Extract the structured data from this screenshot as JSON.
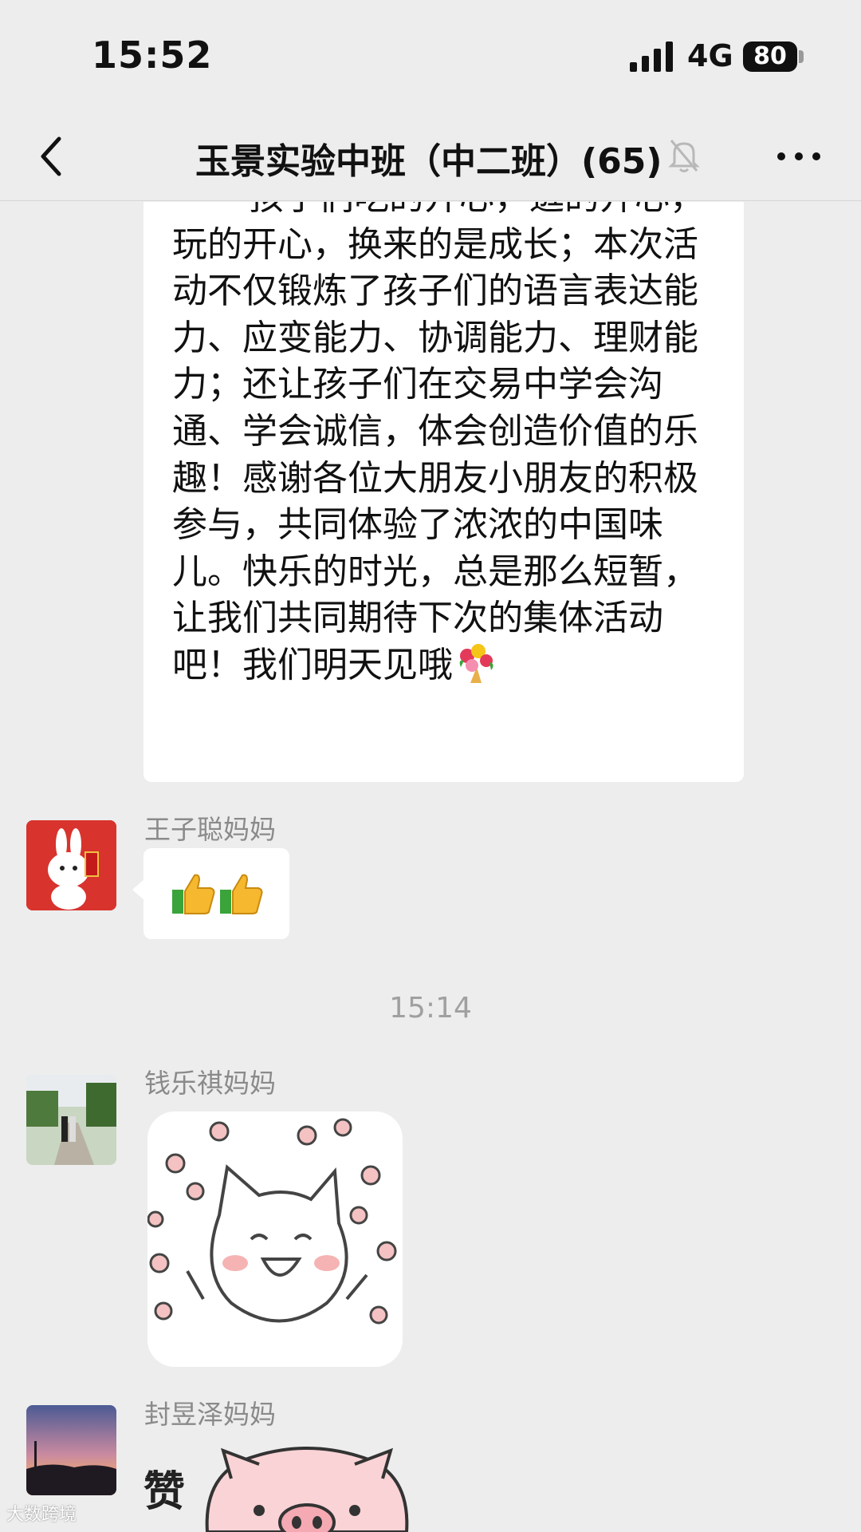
{
  "status": {
    "time": "15:52",
    "network": "4G",
    "battery": "80"
  },
  "header": {
    "title": "玉景实验中班（中二班）(65)"
  },
  "messages": {
    "m1_text": "孩子们吃的开心，逛的开心，玩的开心，换来的是成长；本次活动不仅锻炼了孩子们的语言表达能力、应变能力、协调能力、理财能力；还让孩子们在交易中学会沟通、学会诚信，体会创造价值的乐趣！感谢各位大朋友小朋友的积极参与，共同体验了浓浓的中国味儿。快乐的时光，总是那么短暂，让我们共同期待下次的集体活动吧！我们明天见哦",
    "m1_emoji": "bouquet-icon",
    "m2_sender": "王子聪妈妈",
    "m2_emoji": "thumbs-up-icon",
    "timestamp": "15:14",
    "m3_sender": "钱乐祺妈妈",
    "m4_sender": "封昱泽妈妈",
    "m4_sticker_text": "赞"
  },
  "watermark": "大数跨境",
  "colors": {
    "background": "#ededed",
    "bubble": "#ffffff",
    "name": "#8a8a8a"
  }
}
